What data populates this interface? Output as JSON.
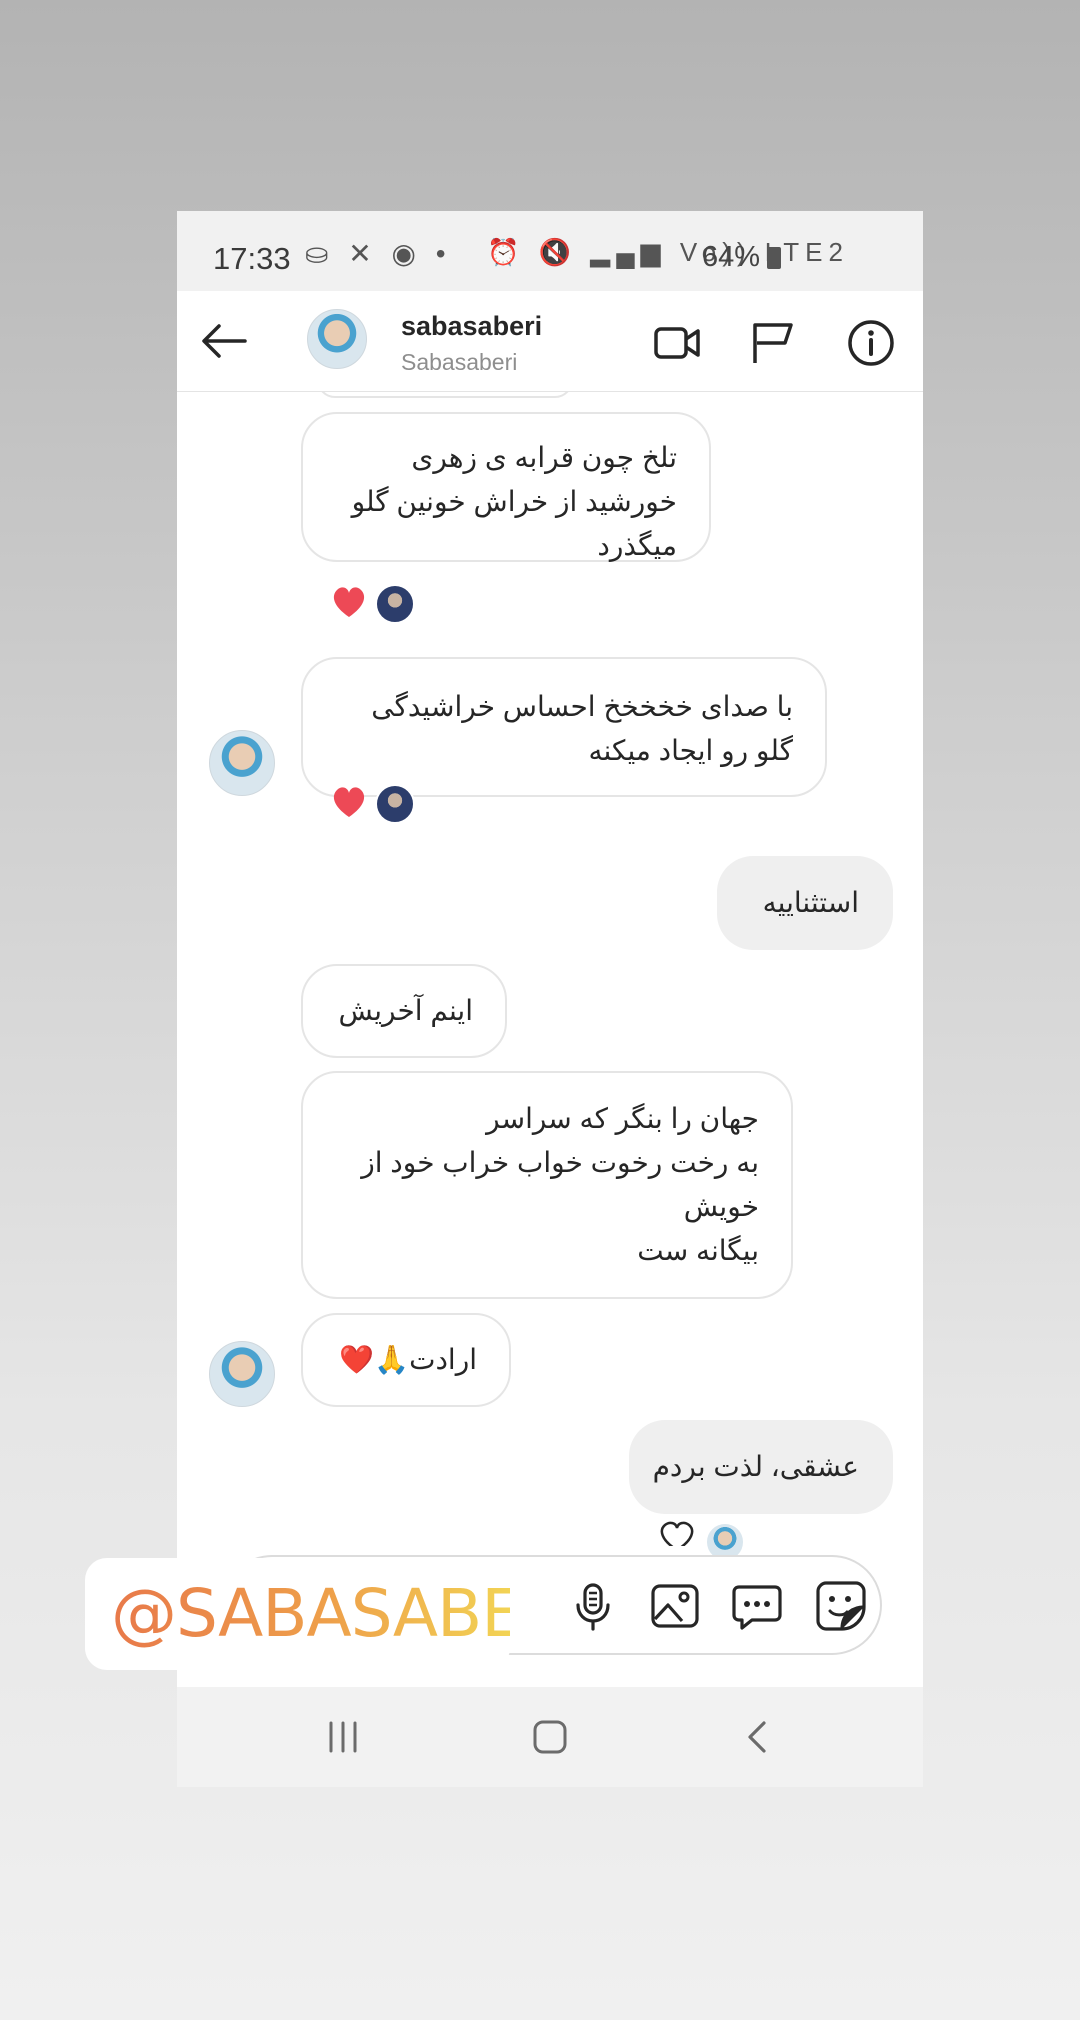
{
  "status_bar": {
    "time": "17:33",
    "left_icons": "⛀ ✕ ◉ •",
    "right_icons": "⏰ 🔇 ▂▄▆ Vo)) LTE2",
    "battery": "64%"
  },
  "header": {
    "username": "sabasaberi",
    "display_name": "Sabasaberi"
  },
  "messages": [
    {
      "side": "received",
      "text": "تلخ چون قرابه ی زهری\nخورشید از خراش خونین گلو\nمیگذرد",
      "reaction": "❤"
    },
    {
      "side": "received",
      "text": "با صدای خخخخخ احساس خراشیدگی\nگلو رو ایجاد میکنه",
      "reaction": "❤"
    },
    {
      "side": "sent",
      "text": "استثناییه"
    },
    {
      "side": "received",
      "text": "اینم آخریش"
    },
    {
      "side": "received",
      "text": "جهان را بنگر که سراسر\nبه رخت رخوت خواب خراب خود از\nخویش\nبیگانه ست"
    },
    {
      "side": "received",
      "text": "ارادت🙏❤️"
    },
    {
      "side": "sent",
      "text": "عشقی، لذت بردم"
    }
  ],
  "composer": {
    "icons": [
      "microphone-icon",
      "image-icon",
      "chat-bubble-icon",
      "sticker-icon"
    ]
  },
  "mention_sticker": "@SABASABERI",
  "colors": {
    "accent_heart": "#ed4956",
    "sent_bubble": "#efefef",
    "mention_gradient_start": "#e8794a",
    "mention_gradient_end": "#f2d354"
  }
}
